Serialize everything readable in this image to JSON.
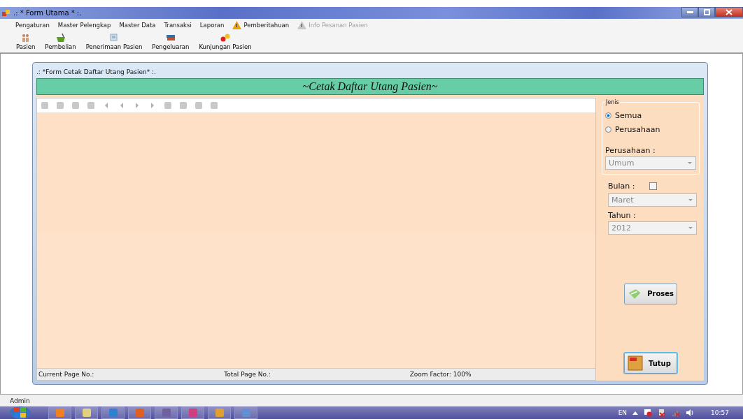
{
  "window": {
    "title": ".: * Form Utama * :."
  },
  "menu": [
    {
      "label": "Pengaturan",
      "disabled": false,
      "kind": "plain"
    },
    {
      "label": "Master Pelengkap",
      "disabled": false,
      "kind": "plain"
    },
    {
      "label": "Master Data",
      "disabled": false,
      "kind": "plain"
    },
    {
      "label": "Transaksi",
      "disabled": false,
      "kind": "plain"
    },
    {
      "label": "Laporan",
      "disabled": false,
      "kind": "plain"
    },
    {
      "label": "Pemberitahuan",
      "disabled": false,
      "kind": "alert"
    },
    {
      "label": "Info Pesanan Pasien",
      "disabled": true,
      "kind": "alert"
    }
  ],
  "toolbar": [
    {
      "label": "Pasien"
    },
    {
      "label": "Pembelian"
    },
    {
      "label": "Penerimaan Pasien"
    },
    {
      "label": "Pengeluaran"
    },
    {
      "label": "Kunjungan Pasien"
    }
  ],
  "child_form": {
    "title": ".: *Form Cetak Daftar Utang Pasien* :.",
    "banner": "~Cetak Daftar Utang Pasien~",
    "viewer_status": [
      "Current Page No.:",
      "Total Page No.:",
      "Zoom Factor: 100%"
    ]
  },
  "jenis": {
    "legend": "Jenis",
    "options": [
      {
        "label": "Semua",
        "selected": true
      },
      {
        "label": "Perusahaan",
        "selected": false
      }
    ],
    "perusahaan_label": "Perusahaan :",
    "perusahaan_value": "Umum"
  },
  "bulan": {
    "label": "Bulan :",
    "checked": false,
    "value": "Maret"
  },
  "tahun": {
    "label": "Tahun :",
    "value": "2012"
  },
  "buttons": [
    {
      "label": "Proses",
      "kind": "proses"
    },
    {
      "label": "Tutup",
      "kind": "exit"
    }
  ],
  "status_bar": {
    "user": "Admin"
  },
  "taskbar": {
    "language": "EN",
    "clock": "10:57"
  }
}
